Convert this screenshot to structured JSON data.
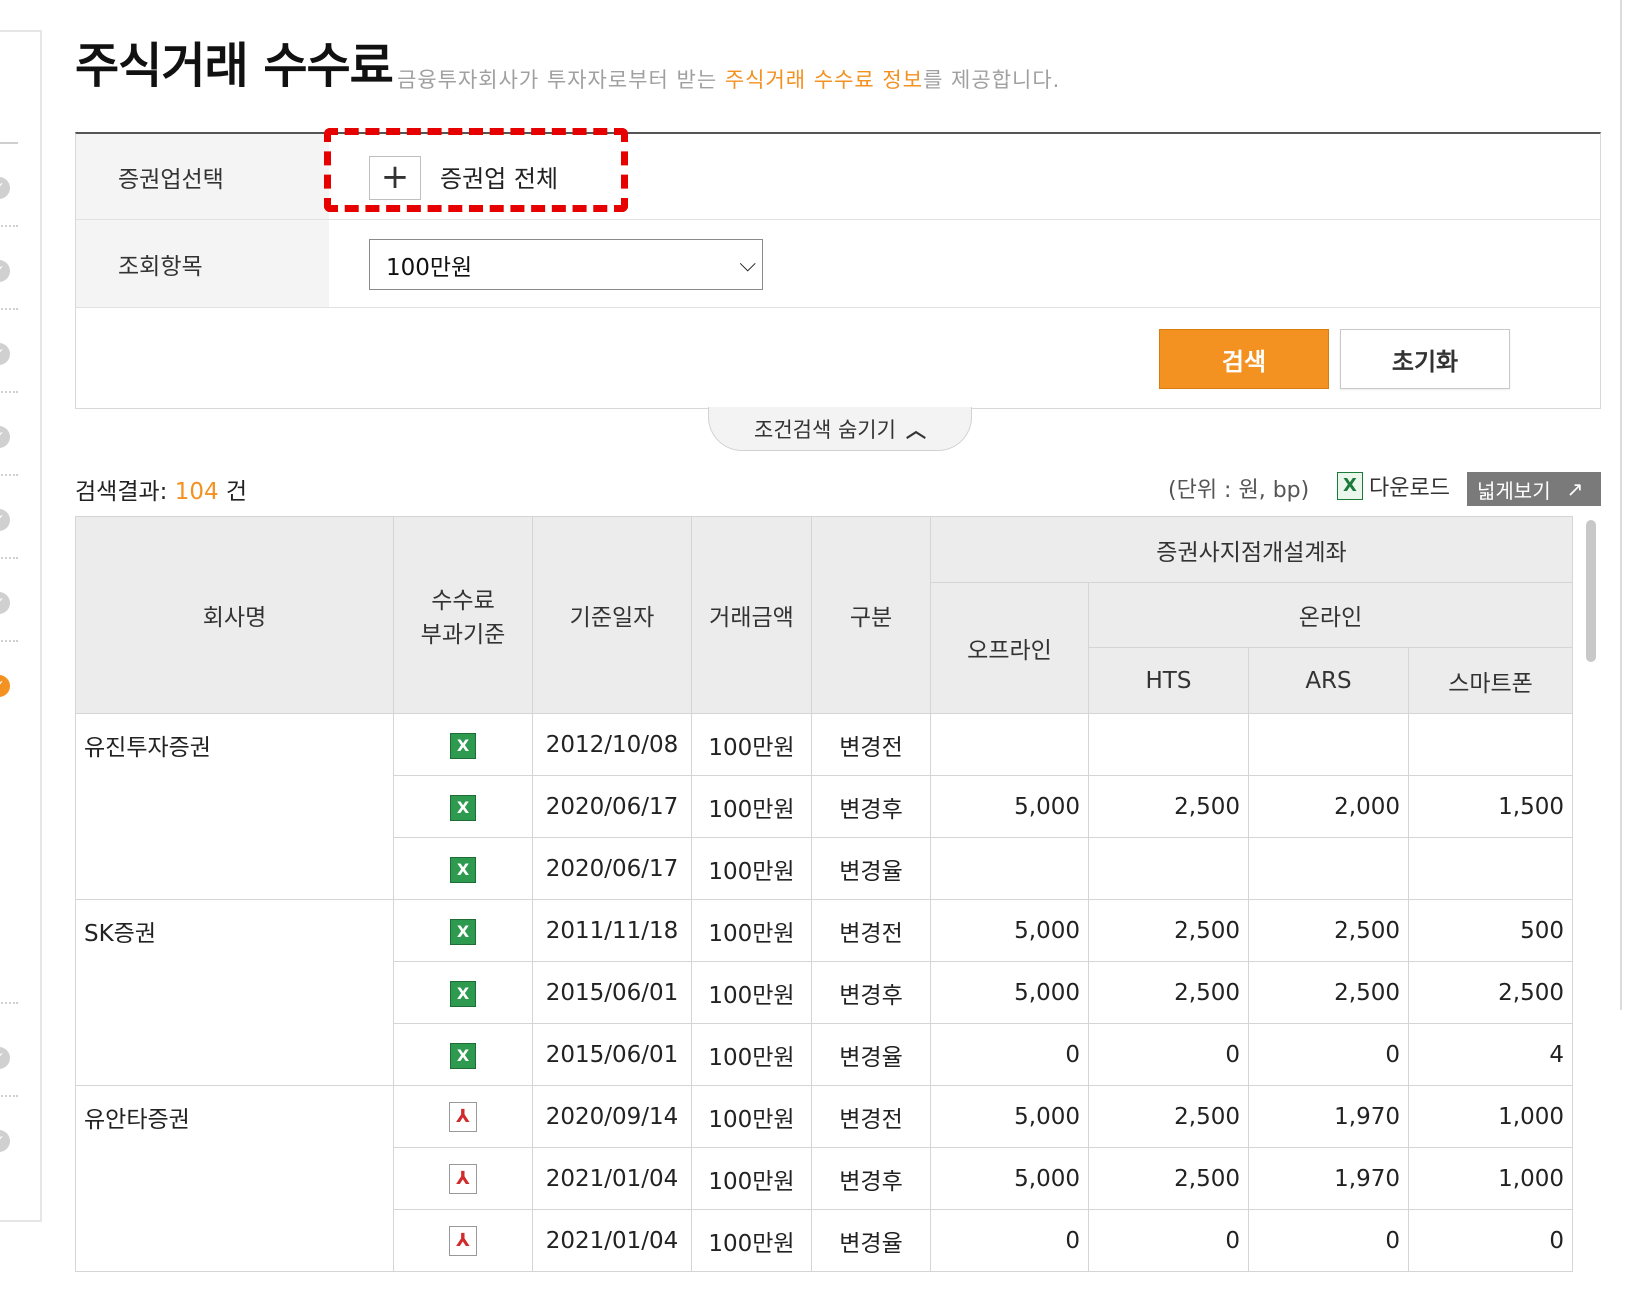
{
  "page": {
    "title": "주식거래 수수료",
    "desc_pre": "금융투자회사가 투자자로부터 받는 ",
    "desc_highlight": "주식거래 수수료 정보",
    "desc_post": "를 제공합니다."
  },
  "search": {
    "broker_label": "증권업선택",
    "broker_value": "증권업 전체",
    "item_label": "조회항목",
    "item_value": "100만원",
    "search_button": "검색",
    "reset_button": "초기화",
    "hide_toggle": "조건검색 숨기기"
  },
  "results": {
    "label": "검색결과:",
    "count": "104",
    "unit_suffix": "건",
    "unit_note": "(단위 : 원, bp)",
    "download": "다운로드",
    "wide_view": "넓게보기"
  },
  "table": {
    "headers": {
      "company": "회사명",
      "fee_basis_line1": "수수료",
      "fee_basis_line2": "부과기준",
      "base_date": "기준일자",
      "amount": "거래금액",
      "category": "구분",
      "branch_account": "증권사지점개설계좌",
      "offline": "오프라인",
      "online": "온라인",
      "hts": "HTS",
      "ars": "ARS",
      "smartphone": "스마트폰"
    },
    "groups": [
      {
        "company": "유진투자증권",
        "rows": [
          {
            "doc": "xls",
            "date": "2012/10/08",
            "amount": "100만원",
            "category": "변경전",
            "offline": "",
            "hts": "",
            "ars": "",
            "smartphone": ""
          },
          {
            "doc": "xls",
            "date": "2020/06/17",
            "amount": "100만원",
            "category": "변경후",
            "offline": "5,000",
            "hts": "2,500",
            "ars": "2,000",
            "smartphone": "1,500"
          },
          {
            "doc": "xls",
            "date": "2020/06/17",
            "amount": "100만원",
            "category": "변경율",
            "offline": "",
            "hts": "",
            "ars": "",
            "smartphone": ""
          }
        ]
      },
      {
        "company": "SK증권",
        "rows": [
          {
            "doc": "xls",
            "date": "2011/11/18",
            "amount": "100만원",
            "category": "변경전",
            "offline": "5,000",
            "hts": "2,500",
            "ars": "2,500",
            "smartphone": "500"
          },
          {
            "doc": "xls",
            "date": "2015/06/01",
            "amount": "100만원",
            "category": "변경후",
            "offline": "5,000",
            "hts": "2,500",
            "ars": "2,500",
            "smartphone": "2,500"
          },
          {
            "doc": "xls",
            "date": "2015/06/01",
            "amount": "100만원",
            "category": "변경율",
            "offline": "0",
            "hts": "0",
            "ars": "0",
            "smartphone": "4"
          }
        ]
      },
      {
        "company": "유안타증권",
        "rows": [
          {
            "doc": "pdf",
            "date": "2020/09/14",
            "amount": "100만원",
            "category": "변경전",
            "offline": "5,000",
            "hts": "2,500",
            "ars": "1,970",
            "smartphone": "1,000"
          },
          {
            "doc": "pdf",
            "date": "2021/01/04",
            "amount": "100만원",
            "category": "변경후",
            "offline": "5,000",
            "hts": "2,500",
            "ars": "1,970",
            "smartphone": "1,000"
          },
          {
            "doc": "pdf",
            "date": "2021/01/04",
            "amount": "100만원",
            "category": "변경율",
            "offline": "0",
            "hts": "0",
            "ars": "0",
            "smartphone": "0"
          }
        ]
      }
    ]
  },
  "icons": {
    "excel": "excel-icon",
    "pdf": "pdf-icon",
    "plus": "plus-icon",
    "check": "check-icon",
    "external": "external-link-icon"
  },
  "colors": {
    "accent": "#f39121",
    "highlight_border": "#e60000"
  }
}
